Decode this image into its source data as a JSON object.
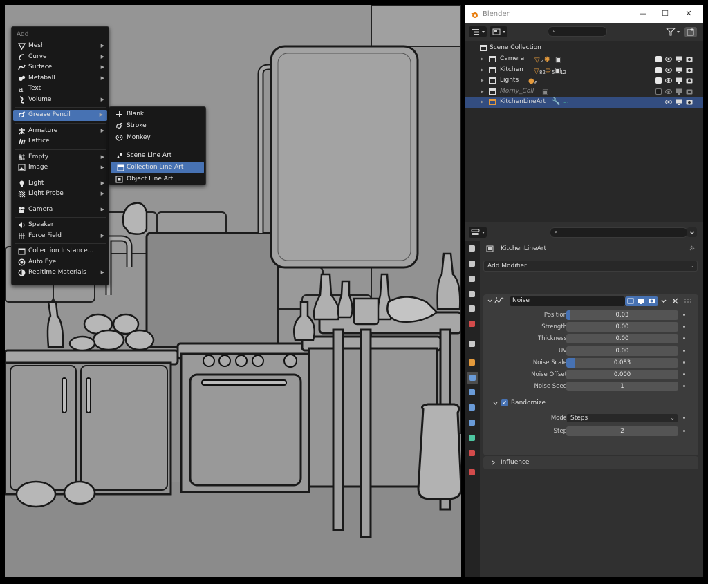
{
  "add_menu": {
    "title": "Add",
    "items": [
      {
        "label": "Mesh",
        "icon": "mesh-icon",
        "sub": true
      },
      {
        "label": "Curve",
        "icon": "curve-icon",
        "sub": true
      },
      {
        "label": "Surface",
        "icon": "surface-icon",
        "sub": true
      },
      {
        "label": "Metaball",
        "icon": "metaball-icon",
        "sub": true
      },
      {
        "label": "Text",
        "icon": "text-icon",
        "sub": false
      },
      {
        "label": "Volume",
        "icon": "volume-icon",
        "sub": true
      },
      {
        "label": "Grease Pencil",
        "icon": "grease-pencil-icon",
        "sub": true,
        "active": true
      },
      {
        "label": "Armature",
        "icon": "armature-icon",
        "sub": true
      },
      {
        "label": "Lattice",
        "icon": "lattice-icon",
        "sub": false
      },
      {
        "label": "Empty",
        "icon": "empty-icon",
        "sub": true
      },
      {
        "label": "Image",
        "icon": "image-icon",
        "sub": true
      },
      {
        "label": "Light",
        "icon": "light-icon",
        "sub": true
      },
      {
        "label": "Light Probe",
        "icon": "light-probe-icon",
        "sub": true
      },
      {
        "label": "Camera",
        "icon": "camera-icon",
        "sub": true
      },
      {
        "label": "Speaker",
        "icon": "speaker-icon",
        "sub": false
      },
      {
        "label": "Force Field",
        "icon": "force-field-icon",
        "sub": true
      },
      {
        "label": "Collection Instance...",
        "icon": "collection-instance-icon",
        "sub": false
      },
      {
        "label": "Auto Eye",
        "icon": "auto-eye-icon",
        "sub": false
      },
      {
        "label": "Realtime Materials",
        "icon": "realtime-materials-icon",
        "sub": true
      }
    ]
  },
  "gp_menu": {
    "items": [
      {
        "label": "Blank",
        "icon": "blank-icon"
      },
      {
        "label": "Stroke",
        "icon": "stroke-icon"
      },
      {
        "label": "Monkey",
        "icon": "monkey-icon"
      },
      {
        "label": "Scene Line Art",
        "icon": "scene-line-art-icon"
      },
      {
        "label": "Collection Line Art",
        "icon": "collection-line-art-icon",
        "active": true
      },
      {
        "label": "Object Line Art",
        "icon": "object-line-art-icon"
      }
    ]
  },
  "window": {
    "title": "Blender",
    "minimize": "—",
    "maximize": "☐",
    "close": "✕"
  },
  "outliner": {
    "scene_collection": "Scene Collection",
    "rows": [
      {
        "label": "Camera",
        "badges": [
          "2",
          "",
          ""
        ],
        "checked": true,
        "selected": false,
        "dim": false
      },
      {
        "label": "Kitchen",
        "badges": [
          "82",
          "5",
          "12"
        ],
        "checked": true,
        "selected": false,
        "dim": false
      },
      {
        "label": "Lights",
        "badges": [
          "6"
        ],
        "checked": true,
        "selected": false,
        "dim": false
      },
      {
        "label": "Morny_Coll",
        "badges": [],
        "checked": false,
        "selected": false,
        "dim": true
      },
      {
        "label": "KitchenLineArt",
        "badges": [],
        "checked": null,
        "selected": true,
        "dim": false
      }
    ]
  },
  "properties": {
    "object_name": "KitchenLineArt",
    "add_modifier": "Add Modifier",
    "modifier": {
      "name": "Noise",
      "fields": [
        {
          "label": "Position",
          "value": "0.03",
          "fill": 0.03
        },
        {
          "label": "Strength",
          "value": "0.00",
          "fill": 0
        },
        {
          "label": "Thickness",
          "value": "0.00",
          "fill": 0
        },
        {
          "label": "UV",
          "value": "0.00",
          "fill": 0
        },
        {
          "label": "Noise Scale",
          "value": "0.083",
          "fill": 0.083
        },
        {
          "label": "Noise Offset",
          "value": "0.000",
          "fill": 0
        },
        {
          "label": "Noise Seed",
          "value": "1",
          "fill": 0
        }
      ],
      "randomize": {
        "label": "Randomize",
        "checked": true,
        "mode_label": "Mode",
        "mode_value": "Steps",
        "step_label": "Step",
        "step_value": "2"
      },
      "influence": "Influence"
    }
  },
  "colors": {
    "accent": "#4772b3",
    "selection": "#334d80",
    "viewport": "#8f8f8f"
  }
}
